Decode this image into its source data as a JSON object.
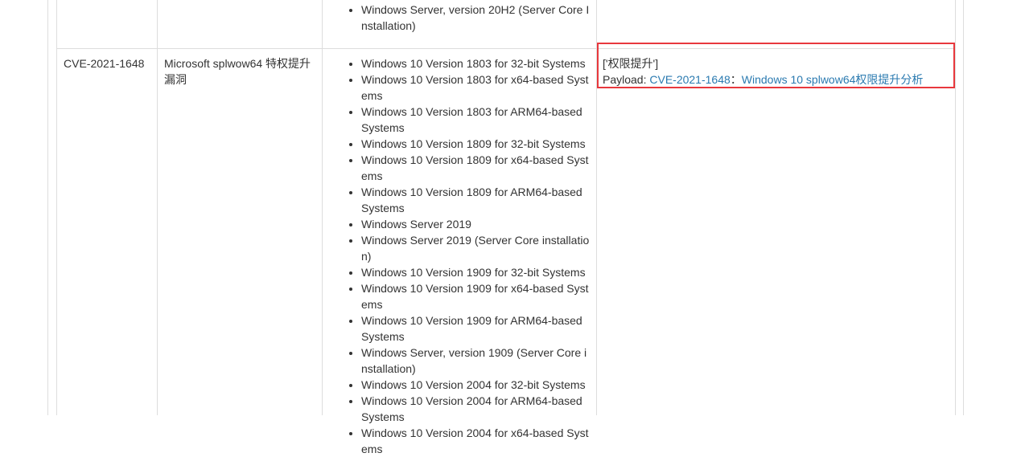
{
  "previous_row": {
    "affected_systems": [
      "Windows Server, version 20H2 (Server Core Installation)"
    ]
  },
  "row": {
    "cve_id": "CVE-2021-1648",
    "name": "Microsoft splwow64 特权提升漏洞",
    "affected_systems": [
      "Windows 10 Version 1803 for 32-bit Systems",
      "Windows 10 Version 1803 for x64-based Systems",
      "Windows 10 Version 1803 for ARM64-based Systems",
      "Windows 10 Version 1809 for 32-bit Systems",
      "Windows 10 Version 1809 for x64-based Systems",
      "Windows 10 Version 1809 for ARM64-based Systems",
      "Windows Server 2019",
      "Windows Server 2019 (Server Core installation)",
      "Windows 10 Version 1909 for 32-bit Systems",
      "Windows 10 Version 1909 for x64-based Systems",
      "Windows 10 Version 1909 for ARM64-based Systems",
      "Windows Server, version 1909 (Server Core installation)",
      "Windows 10 Version 2004 for 32-bit Systems",
      "Windows 10 Version 2004 for ARM64-based Systems",
      "Windows 10 Version 2004 for x64-based Systems"
    ],
    "payload": {
      "type": "['权限提升']",
      "label": "Payload: ",
      "link_cve": "CVE-2021-1648",
      "separator": "：",
      "link_article": "Windows 10 splwow64权限提升分析"
    }
  },
  "colors": {
    "border": "#dddddd",
    "highlight": "#e8383d",
    "link": "#2a7ab0",
    "text": "#333333"
  }
}
